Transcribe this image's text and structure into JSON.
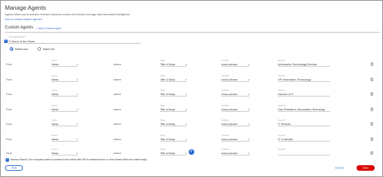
{
  "header": {
    "title": "Manage Agents",
    "description": "Agents allow you to monitor relevant business events and media coverage with increased intelligence.",
    "howto_link": "How to create custom agents?"
  },
  "section": {
    "title": "Custom Agents",
    "add_label": "Add a Custom Agent"
  },
  "agent": {
    "name_label": "Your Agent Name*",
    "name_value": "IT Execs In the News",
    "match_any": "Match Any",
    "match_all": "Match All"
  },
  "rule_labels": {
    "find": "Find",
    "source": "Source",
    "where": "where",
    "target": "Target",
    "condition": "Condition",
    "keyword": "Keyword*"
  },
  "rules": [
    {
      "source": "News",
      "target": "Title & Body",
      "condition": "exact phrase",
      "keyword": "Information Technology Director"
    },
    {
      "source": "News",
      "target": "Title & Body",
      "condition": "exact phrase",
      "keyword": "VP Information Technology"
    },
    {
      "source": "News",
      "target": "Title & Body",
      "condition": "exact phrase",
      "keyword": "Director of IT"
    },
    {
      "source": "News",
      "target": "Title & Body",
      "condition": "exact phrase",
      "keyword": "Vice President, Information Technolog"
    },
    {
      "source": "News",
      "target": "Title & Body",
      "condition": "exact phrase",
      "keyword": "IT Director"
    },
    {
      "source": "News",
      "target": "Title & Body",
      "condition": "exact phrase",
      "keyword": "IT Controller"
    },
    {
      "source": "News",
      "target": "Title & Body",
      "condition": "exact phrase",
      "keyword": ""
    }
  ],
  "narrow_search": "Narrow Search (The company name is present in the article title OR is mentioned four or more times within the article body)",
  "footer": {
    "test": "Test",
    "cancel": "Cancel",
    "save": "Save"
  },
  "icons": {
    "add": "plus-icon",
    "delete": "trash-icon",
    "dropdown": "chevron-down-icon"
  },
  "colors": {
    "accent": "#2a6bcc",
    "save": "#d90000"
  }
}
